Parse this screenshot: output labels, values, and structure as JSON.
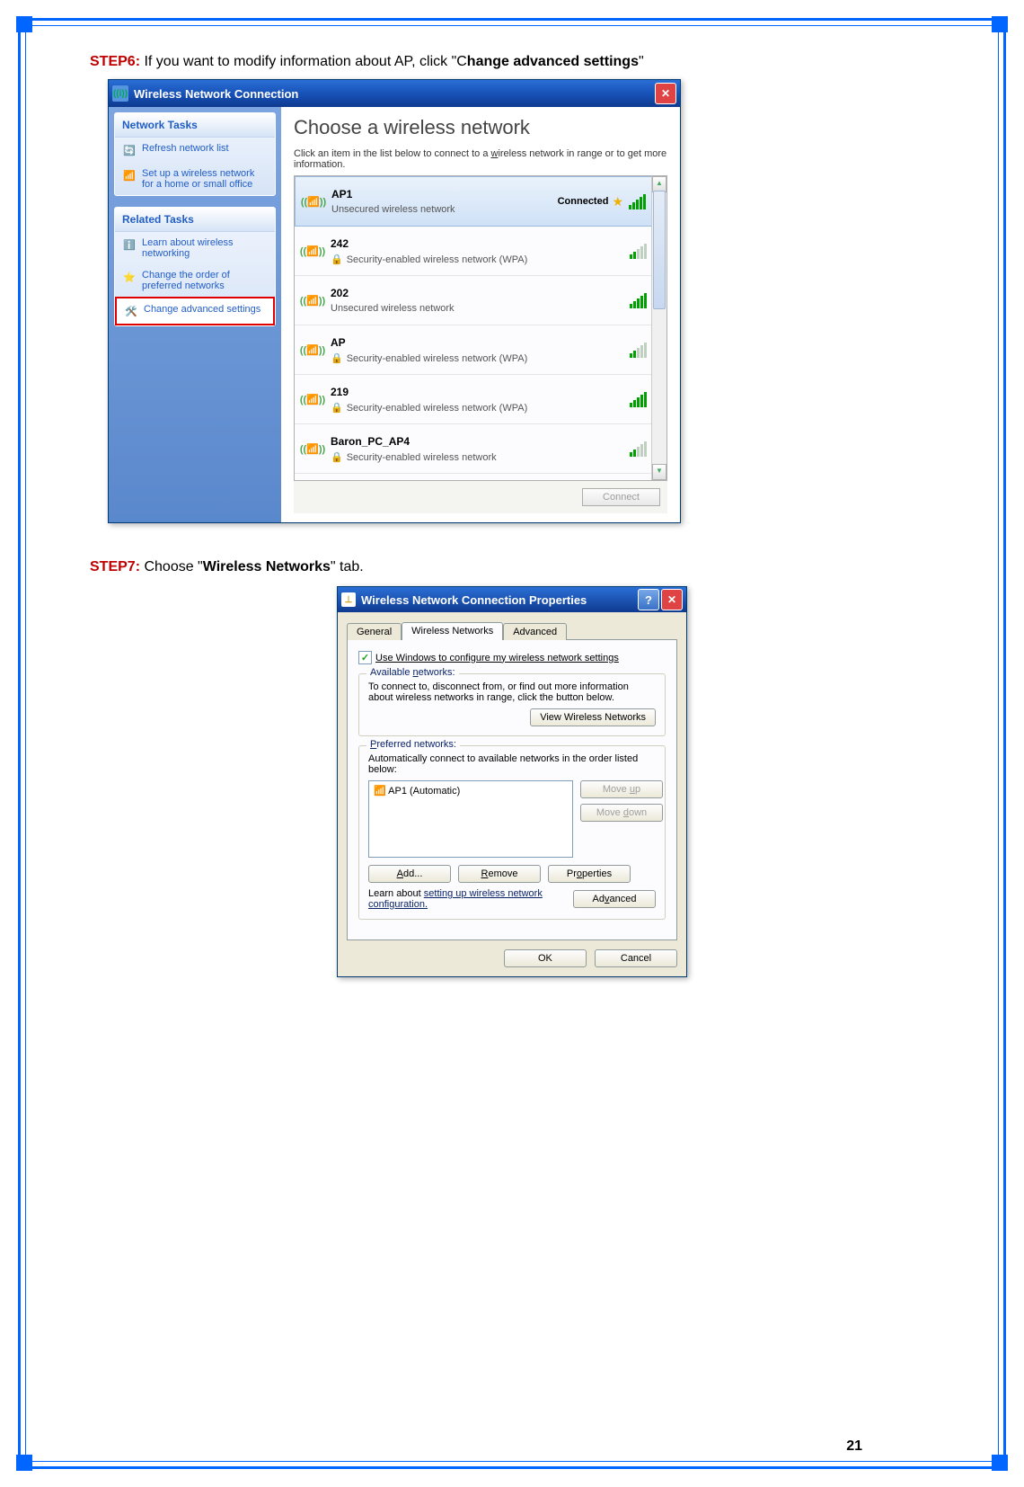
{
  "step6": {
    "label": "STEP6:",
    "text_a": " If you want to modify information about AP, click \"C",
    "bold": "hange advanced settings",
    "text_b": "\""
  },
  "step7": {
    "label": "STEP7:",
    "text_a": " Choose \"",
    "bold": "Wireless Networks",
    "text_b": "\" tab."
  },
  "wnc": {
    "title": "Wireless Network Connection",
    "sidebar": {
      "panel1_head": "Network Tasks",
      "items1": [
        "Refresh network list",
        "Set up a wireless network for a home or small office"
      ],
      "panel2_head": "Related Tasks",
      "items2": [
        "Learn about wireless networking",
        "Change the order of preferred networks",
        "Change advanced settings"
      ]
    },
    "main": {
      "title": "Choose a wireless network",
      "sub": "Click an item in the list below to connect to a wireless network in range or to get more information.",
      "connected": "Connected",
      "networks": [
        {
          "name": "AP1",
          "sec": "Unsecured wireless network",
          "lock": false,
          "connected": true,
          "weak": false
        },
        {
          "name": "242",
          "sec": "Security-enabled wireless network (WPA)",
          "lock": true,
          "connected": false,
          "weak": true
        },
        {
          "name": "202",
          "sec": "Unsecured wireless network",
          "lock": false,
          "connected": false,
          "weak": false
        },
        {
          "name": "AP",
          "sec": "Security-enabled wireless network (WPA)",
          "lock": true,
          "connected": false,
          "weak": true
        },
        {
          "name": "219",
          "sec": "Security-enabled wireless network (WPA)",
          "lock": true,
          "connected": false,
          "weak": false
        },
        {
          "name": "Baron_PC_AP4",
          "sec": "Security-enabled wireless network",
          "lock": true,
          "connected": false,
          "weak": true
        }
      ],
      "connect_btn": "Connect"
    }
  },
  "props": {
    "title": "Wireless Network Connection Properties",
    "tabs": [
      "General",
      "Wireless Networks",
      "Advanced"
    ],
    "checkbox": "Use Windows to configure my wireless network settings",
    "available": {
      "legend": "Available networks:",
      "text": "To connect to, disconnect from, or find out more information about wireless networks in range, click the button below.",
      "btn": "View Wireless Networks"
    },
    "preferred": {
      "legend": "Preferred networks:",
      "text": "Automatically connect to available networks in the order listed below:",
      "item": "AP1 (Automatic)",
      "move_up": "Move up",
      "move_down": "Move down",
      "add": "Add...",
      "remove": "Remove",
      "properties": "Properties"
    },
    "learn_a": "Learn about ",
    "learn_link": "setting up wireless network configuration.",
    "advanced": "Advanced",
    "ok": "OK",
    "cancel": "Cancel"
  },
  "page_num": "21"
}
